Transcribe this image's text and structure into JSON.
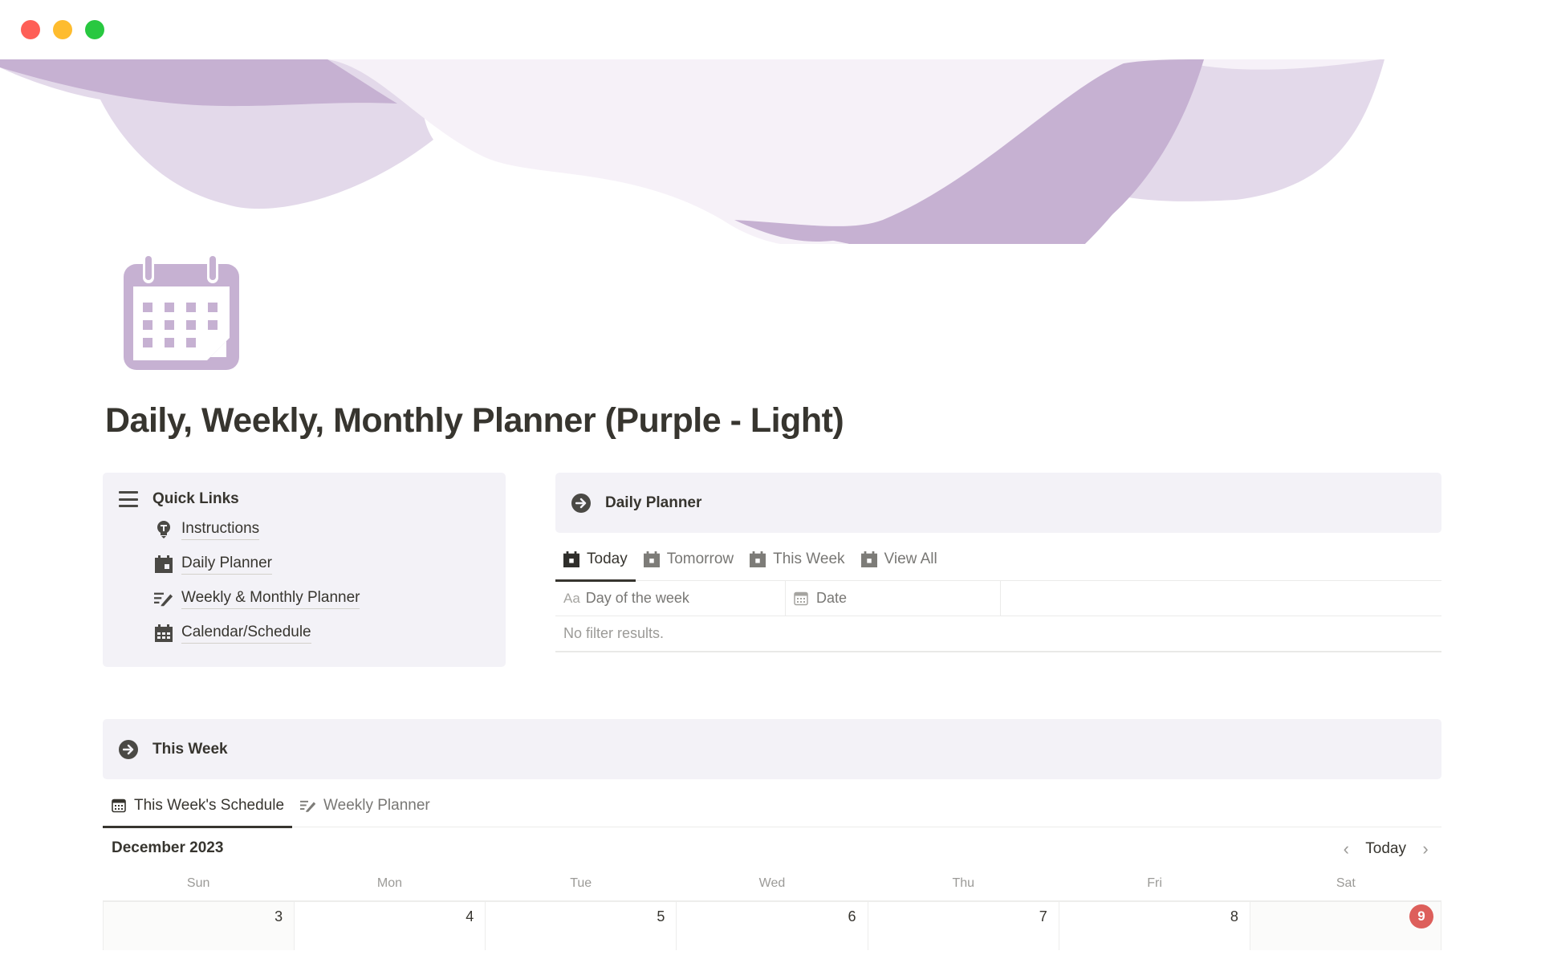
{
  "window": {
    "controls": [
      "close",
      "minimize",
      "zoom"
    ]
  },
  "colors": {
    "banner_dark": "#c6b1d2",
    "banner_mid": "#e3d9ea",
    "banner_light": "#f6f1f8",
    "icon_purple": "#c6b1d2",
    "callout_bg": "#f3f2f7",
    "today_badge": "#dd5f5b"
  },
  "page": {
    "icon": "calendar-icon",
    "title": "Daily, Weekly, Monthly Planner (Purple - Light)"
  },
  "quick_links": {
    "title": "Quick Links",
    "icon": "menu-icon",
    "items": [
      {
        "label": "Instructions",
        "icon": "lightbulb-icon"
      },
      {
        "label": "Daily Planner",
        "icon": "calendar-day-icon"
      },
      {
        "label": "Weekly & Monthly Planner",
        "icon": "edit-list-icon"
      },
      {
        "label": "Calendar/Schedule",
        "icon": "calendar-grid-icon"
      }
    ]
  },
  "daily_planner": {
    "title": "Daily Planner",
    "icon": "arrow-right-circle-icon",
    "tabs": [
      {
        "label": "Today",
        "active": true
      },
      {
        "label": "Tomorrow",
        "active": false
      },
      {
        "label": "This Week",
        "active": false
      },
      {
        "label": "View All",
        "active": false
      }
    ],
    "table": {
      "columns": [
        {
          "label": "Day of the week",
          "icon_text": "Aa"
        },
        {
          "label": "Date",
          "icon": "calendar-small-icon"
        }
      ],
      "empty_text": "No filter results."
    }
  },
  "this_week": {
    "title": "This Week",
    "icon": "arrow-right-circle-icon",
    "tabs": [
      {
        "label": "This Week's Schedule",
        "active": true,
        "icon": "calendar-small-icon"
      },
      {
        "label": "Weekly Planner",
        "active": false,
        "icon": "edit-list-icon"
      }
    ],
    "calendar": {
      "month_label": "December 2023",
      "today_button": "Today",
      "prev": "‹",
      "next": "›",
      "day_headers": [
        "Sun",
        "Mon",
        "Tue",
        "Wed",
        "Thu",
        "Fri",
        "Sat"
      ],
      "days": [
        {
          "num": "3",
          "weekend": true,
          "today": false
        },
        {
          "num": "4",
          "weekend": false,
          "today": false
        },
        {
          "num": "5",
          "weekend": false,
          "today": false
        },
        {
          "num": "6",
          "weekend": false,
          "today": false
        },
        {
          "num": "7",
          "weekend": false,
          "today": false
        },
        {
          "num": "8",
          "weekend": false,
          "today": false
        },
        {
          "num": "9",
          "weekend": true,
          "today": true
        }
      ]
    }
  }
}
